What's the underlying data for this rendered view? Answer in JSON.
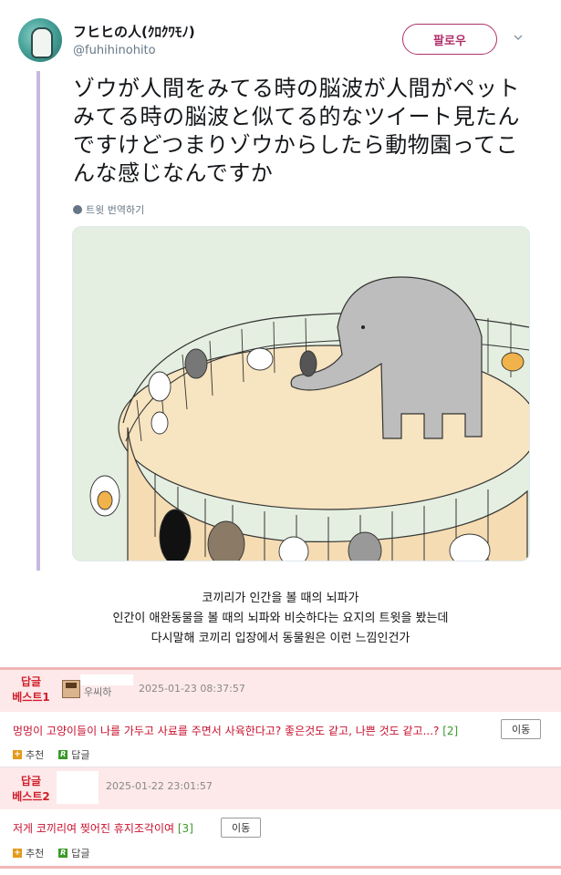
{
  "tweet": {
    "display_name": "フヒヒの人(ｸﾛｸﾜﾓﾉ)",
    "handle": "@fuhihinohito",
    "follow_label": "팔로우",
    "text": "ゾウが人間をみてる時の脳波が人間がペットみてる時の脳波と似てる的なツイート見たんですけどつまりゾウからしたら動物園ってこんな感じなんですか",
    "translate_label": "트윗 번역하기"
  },
  "caption": {
    "line1": "코끼리가 인간을 볼 때의 뇌파가",
    "line2": "인간이 애완동물을 볼 때의 뇌파와 비슷하다는 요지의 트윗을 봤는데",
    "line3": "다시말해 코끼리 입장에서 동물원은 이런 느낌인건가"
  },
  "comments": [
    {
      "label_top": "답글",
      "label_bottom": "베스트1",
      "nick_partial": "우씨하",
      "date": "2025-01-23 08:37:57",
      "text": "멍멍이 고양이들이 나를 가두고 사료를 주면서 사육한다고? 좋은것도 같고, 나쁜 것도 같고...?",
      "reply_count": "[2]",
      "move_label": "이동",
      "recommend_label": "추천",
      "reply_label": "답글"
    },
    {
      "label_top": "답글",
      "label_bottom": "베스트2",
      "date": "2025-01-22 23:01:57",
      "text": "저게 코끼리여 찢어진 휴지조각이여",
      "reply_count": "[3]",
      "move_label": "이동",
      "recommend_label": "추천",
      "reply_label": "답글"
    }
  ],
  "colors": {
    "follow": "#b0306a",
    "thread_line": "#c8b8df",
    "best_bg": "#fde9ea",
    "best_label": "#d11e2a",
    "comment_text": "#c8102e",
    "reply_count": "#3a9a2a"
  }
}
